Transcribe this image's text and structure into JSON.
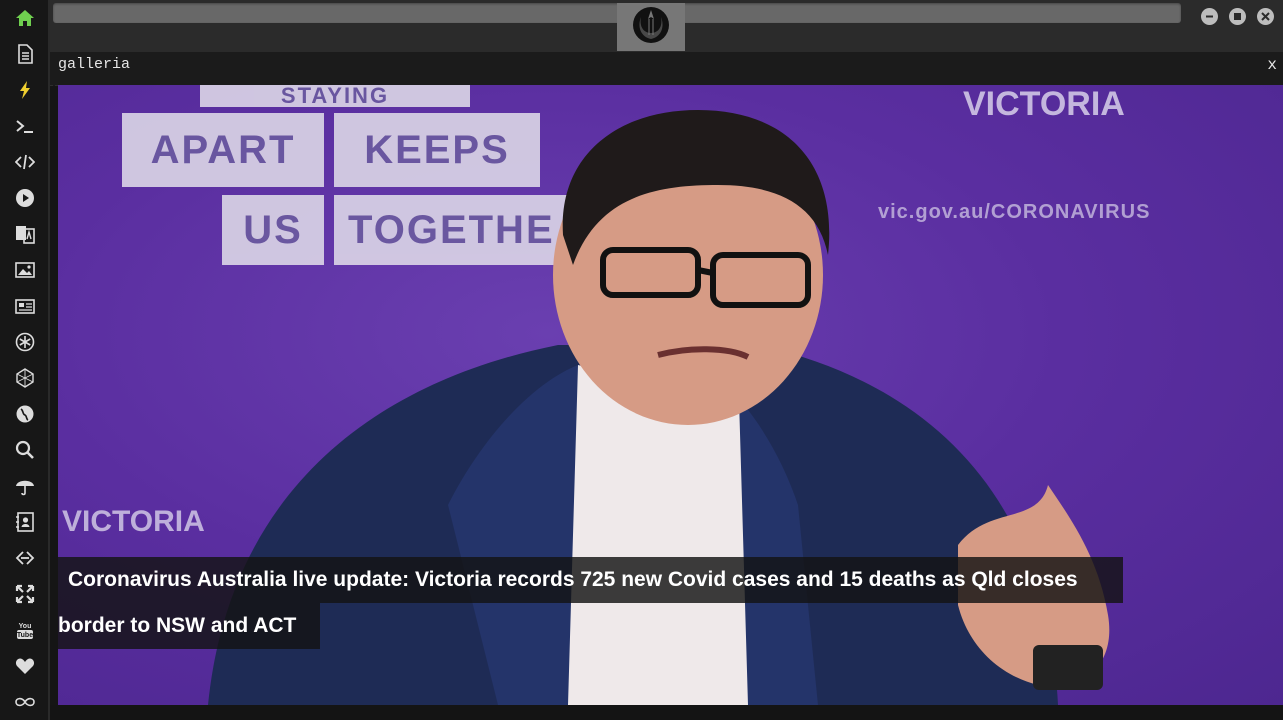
{
  "sidebar": {
    "items": [
      {
        "name": "home-icon",
        "color": "#6fcf4f"
      },
      {
        "name": "document-icon"
      },
      {
        "name": "bolt-icon",
        "color": "#f0d030"
      },
      {
        "name": "terminal-icon"
      },
      {
        "name": "code-icon"
      },
      {
        "name": "play-icon"
      },
      {
        "name": "translate-icon"
      },
      {
        "name": "image-icon"
      },
      {
        "name": "newspaper-icon"
      },
      {
        "name": "settings-icon"
      },
      {
        "name": "network-icon"
      },
      {
        "name": "globe-icon"
      },
      {
        "name": "search-icon"
      },
      {
        "name": "umbrella-icon"
      },
      {
        "name": "contacts-icon"
      },
      {
        "name": "link-icon"
      },
      {
        "name": "expand-icon"
      },
      {
        "name": "youtube-icon"
      },
      {
        "name": "heart-icon"
      },
      {
        "name": "infinity-icon"
      }
    ]
  },
  "topbar": {
    "emblem": "rebel-alliance-icon",
    "buttons": [
      "minimize-icon",
      "maximize-icon",
      "close-icon"
    ]
  },
  "panel": {
    "title": "galleria",
    "close_label": "x"
  },
  "photo": {
    "sign_words": [
      "APART",
      "KEEPS",
      "US",
      "TOGETHE"
    ],
    "sign_top": "STAYING",
    "logo_text": "VICTORIA",
    "url_text": "vic.gov.au/CORONAVIRUS",
    "logo_text_2": "VICTORIA"
  },
  "caption": {
    "line1": "Coronavirus Australia live update: Victoria records 725 new Covid cases and 15 deaths as Qld closes",
    "line2": "border to NSW and ACT"
  },
  "colors": {
    "accent_home": "#6fcf4f",
    "accent_bolt": "#f0d030",
    "background_purple": "#5a2ea0"
  }
}
